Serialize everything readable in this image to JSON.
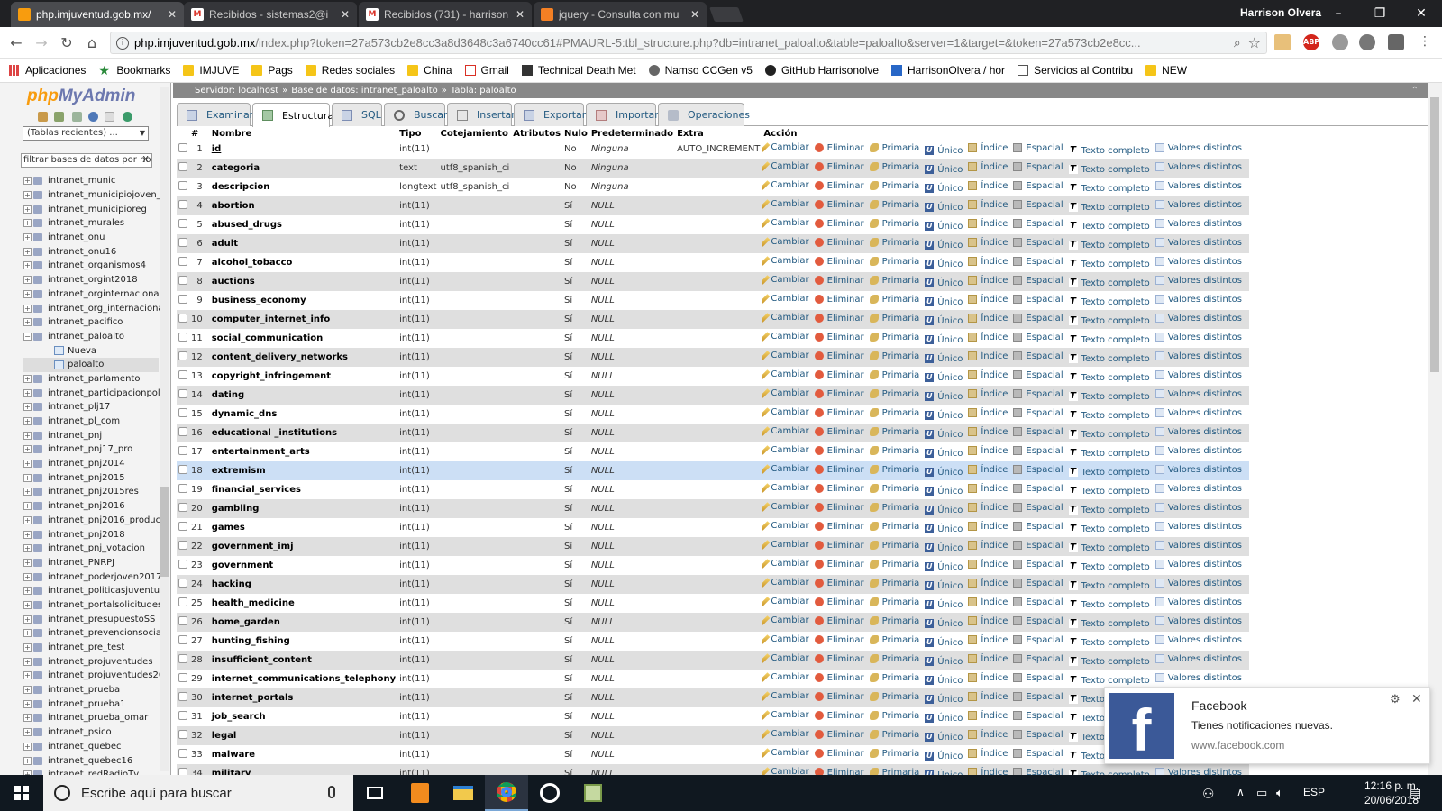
{
  "browser": {
    "tabs": [
      {
        "title": "php.imjuventud.gob.mx/",
        "icon": "pma-icon",
        "active": true
      },
      {
        "title": "Recibidos - sistemas2@i",
        "icon": "gmail-icon",
        "active": false
      },
      {
        "title": "Recibidos (731) - harrison",
        "icon": "gmail-icon",
        "active": false
      },
      {
        "title": "jquery - Consulta con mu",
        "icon": "stackoverflow-icon",
        "active": false
      }
    ],
    "user": "Harrison Olvera",
    "url_host": "php.imjuventud.gob.mx",
    "url_rest": "/index.php?token=27a573cb2e8cc3a8d3648c3a6740cc61#PMAURL-5:tbl_structure.php?db=intranet_paloalto&table=paloalto&server=1&target=&token=27a573cb2e8cc...",
    "bookmarks": [
      "Aplicaciones",
      "Bookmarks",
      "IMJUVE",
      "Pags",
      "Redes sociales",
      "China",
      "Gmail",
      "Technical Death Met",
      "Namso CCGen v5",
      "GitHub Harrisonolve",
      "HarrisonOlvera / hor",
      "Servicios al Contribu",
      "NEW"
    ]
  },
  "sidebar": {
    "logo_php": "php",
    "logo_myadmin": "MyAdmin",
    "recent": "(Tablas recientes) ...",
    "filter_placeholder": "filtrar bases de datos por nom",
    "tree": [
      {
        "name": "intranet_munic",
        "type": "db"
      },
      {
        "name": "intranet_municipiojoven_",
        "type": "db"
      },
      {
        "name": "intranet_municipioreg",
        "type": "db"
      },
      {
        "name": "intranet_murales",
        "type": "db"
      },
      {
        "name": "intranet_onu",
        "type": "db"
      },
      {
        "name": "intranet_onu16",
        "type": "db"
      },
      {
        "name": "intranet_organismos4",
        "type": "db"
      },
      {
        "name": "intranet_orgint2018",
        "type": "db"
      },
      {
        "name": "intranet_orginternacional",
        "type": "db"
      },
      {
        "name": "intranet_org_internaciona",
        "type": "db"
      },
      {
        "name": "intranet_pacifico",
        "type": "db"
      },
      {
        "name": "intranet_paloalto",
        "type": "db-open"
      },
      {
        "name": "Nueva",
        "type": "new"
      },
      {
        "name": "paloalto",
        "type": "table"
      },
      {
        "name": "intranet_parlamento",
        "type": "db"
      },
      {
        "name": "intranet_participacionpoli",
        "type": "db"
      },
      {
        "name": "intranet_plj17",
        "type": "db"
      },
      {
        "name": "intranet_pl_com",
        "type": "db"
      },
      {
        "name": "intranet_pnj",
        "type": "db"
      },
      {
        "name": "intranet_pnj17_pro",
        "type": "db"
      },
      {
        "name": "intranet_pnj2014",
        "type": "db"
      },
      {
        "name": "intranet_pnj2015",
        "type": "db"
      },
      {
        "name": "intranet_pnj2015res",
        "type": "db"
      },
      {
        "name": "intranet_pnj2016",
        "type": "db"
      },
      {
        "name": "intranet_pnj2016_produc",
        "type": "db"
      },
      {
        "name": "intranet_pnj2018",
        "type": "db"
      },
      {
        "name": "intranet_pnj_votacion",
        "type": "db"
      },
      {
        "name": "intranet_PNRPJ",
        "type": "db"
      },
      {
        "name": "intranet_poderjoven2017",
        "type": "db"
      },
      {
        "name": "intranet_politicasjuventuc",
        "type": "db"
      },
      {
        "name": "intranet_portalsolicitudes",
        "type": "db"
      },
      {
        "name": "intranet_presupuestoSS",
        "type": "db"
      },
      {
        "name": "intranet_prevencionsocia",
        "type": "db"
      },
      {
        "name": "intranet_pre_test",
        "type": "db"
      },
      {
        "name": "intranet_projuventudes",
        "type": "db"
      },
      {
        "name": "intranet_projuventudes20",
        "type": "db"
      },
      {
        "name": "intranet_prueba",
        "type": "db"
      },
      {
        "name": "intranet_prueba1",
        "type": "db"
      },
      {
        "name": "intranet_prueba_omar",
        "type": "db"
      },
      {
        "name": "intranet_psico",
        "type": "db"
      },
      {
        "name": "intranet_quebec",
        "type": "db"
      },
      {
        "name": "intranet_quebec16",
        "type": "db"
      },
      {
        "name": "intranet_redRadioTv",
        "type": "db"
      }
    ]
  },
  "breadcrumb": {
    "server": "Servidor: localhost",
    "database": "Base de datos: intranet_paloalto",
    "table": "Tabla: paloalto"
  },
  "tabs": [
    "Examinar",
    "Estructura",
    "SQL",
    "Buscar",
    "Insertar",
    "Exportar",
    "Importar",
    "Operaciones"
  ],
  "active_tab": "Estructura",
  "columns": [
    "#",
    "Nombre",
    "Tipo",
    "Cotejamiento",
    "Atributos",
    "Nulo",
    "Predeterminado",
    "Extra",
    "Acción"
  ],
  "actions": [
    "Cambiar",
    "Eliminar",
    "Primaria",
    "Único",
    "Índice",
    "Espacial",
    "Texto completo",
    "Valores distintos"
  ],
  "rows": [
    {
      "n": "1",
      "name": "id",
      "type": "int(11)",
      "collation": "",
      "null": "No",
      "default": "Ninguna",
      "extra": "AUTO_INCREMENT"
    },
    {
      "n": "2",
      "name": "categoria",
      "type": "text",
      "collation": "utf8_spanish_ci",
      "null": "No",
      "default": "Ninguna",
      "extra": ""
    },
    {
      "n": "3",
      "name": "descripcion",
      "type": "longtext",
      "collation": "utf8_spanish_ci",
      "null": "No",
      "default": "Ninguna",
      "extra": ""
    },
    {
      "n": "4",
      "name": "abortion",
      "type": "int(11)",
      "collation": "",
      "null": "Sí",
      "default": "NULL",
      "extra": ""
    },
    {
      "n": "5",
      "name": "abused_drugs",
      "type": "int(11)",
      "collation": "",
      "null": "Sí",
      "default": "NULL",
      "extra": ""
    },
    {
      "n": "6",
      "name": "adult",
      "type": "int(11)",
      "collation": "",
      "null": "Sí",
      "default": "NULL",
      "extra": ""
    },
    {
      "n": "7",
      "name": "alcohol_tobacco",
      "type": "int(11)",
      "collation": "",
      "null": "Sí",
      "default": "NULL",
      "extra": ""
    },
    {
      "n": "8",
      "name": "auctions",
      "type": "int(11)",
      "collation": "",
      "null": "Sí",
      "default": "NULL",
      "extra": ""
    },
    {
      "n": "9",
      "name": "business_economy",
      "type": "int(11)",
      "collation": "",
      "null": "Sí",
      "default": "NULL",
      "extra": ""
    },
    {
      "n": "10",
      "name": "computer_internet_info",
      "type": "int(11)",
      "collation": "",
      "null": "Sí",
      "default": "NULL",
      "extra": ""
    },
    {
      "n": "11",
      "name": "social_communication",
      "type": "int(11)",
      "collation": "",
      "null": "Sí",
      "default": "NULL",
      "extra": ""
    },
    {
      "n": "12",
      "name": "content_delivery_networks",
      "type": "int(11)",
      "collation": "",
      "null": "Sí",
      "default": "NULL",
      "extra": ""
    },
    {
      "n": "13",
      "name": "copyright_infringement",
      "type": "int(11)",
      "collation": "",
      "null": "Sí",
      "default": "NULL",
      "extra": ""
    },
    {
      "n": "14",
      "name": "dating",
      "type": "int(11)",
      "collation": "",
      "null": "Sí",
      "default": "NULL",
      "extra": ""
    },
    {
      "n": "15",
      "name": "dynamic_dns",
      "type": "int(11)",
      "collation": "",
      "null": "Sí",
      "default": "NULL",
      "extra": ""
    },
    {
      "n": "16",
      "name": "educational _institutions",
      "type": "int(11)",
      "collation": "",
      "null": "Sí",
      "default": "NULL",
      "extra": ""
    },
    {
      "n": "17",
      "name": "entertainment_arts",
      "type": "int(11)",
      "collation": "",
      "null": "Sí",
      "default": "NULL",
      "extra": ""
    },
    {
      "n": "18",
      "name": "extremism",
      "type": "int(11)",
      "collation": "",
      "null": "Sí",
      "default": "NULL",
      "extra": ""
    },
    {
      "n": "19",
      "name": "financial_services",
      "type": "int(11)",
      "collation": "",
      "null": "Sí",
      "default": "NULL",
      "extra": ""
    },
    {
      "n": "20",
      "name": "gambling",
      "type": "int(11)",
      "collation": "",
      "null": "Sí",
      "default": "NULL",
      "extra": ""
    },
    {
      "n": "21",
      "name": "games",
      "type": "int(11)",
      "collation": "",
      "null": "Sí",
      "default": "NULL",
      "extra": ""
    },
    {
      "n": "22",
      "name": "government_imj",
      "type": "int(11)",
      "collation": "",
      "null": "Sí",
      "default": "NULL",
      "extra": ""
    },
    {
      "n": "23",
      "name": "government",
      "type": "int(11)",
      "collation": "",
      "null": "Sí",
      "default": "NULL",
      "extra": ""
    },
    {
      "n": "24",
      "name": "hacking",
      "type": "int(11)",
      "collation": "",
      "null": "Sí",
      "default": "NULL",
      "extra": ""
    },
    {
      "n": "25",
      "name": "health_medicine",
      "type": "int(11)",
      "collation": "",
      "null": "Sí",
      "default": "NULL",
      "extra": ""
    },
    {
      "n": "26",
      "name": "home_garden",
      "type": "int(11)",
      "collation": "",
      "null": "Sí",
      "default": "NULL",
      "extra": ""
    },
    {
      "n": "27",
      "name": "hunting_fishing",
      "type": "int(11)",
      "collation": "",
      "null": "Sí",
      "default": "NULL",
      "extra": ""
    },
    {
      "n": "28",
      "name": "insufficient_content",
      "type": "int(11)",
      "collation": "",
      "null": "Sí",
      "default": "NULL",
      "extra": ""
    },
    {
      "n": "29",
      "name": "internet_communications_telephony",
      "type": "int(11)",
      "collation": "",
      "null": "Sí",
      "default": "NULL",
      "extra": ""
    },
    {
      "n": "30",
      "name": "internet_portals",
      "type": "int(11)",
      "collation": "",
      "null": "Sí",
      "default": "NULL",
      "extra": ""
    },
    {
      "n": "31",
      "name": "job_search",
      "type": "int(11)",
      "collation": "",
      "null": "Sí",
      "default": "NULL",
      "extra": ""
    },
    {
      "n": "32",
      "name": "legal",
      "type": "int(11)",
      "collation": "",
      "null": "Sí",
      "default": "NULL",
      "extra": ""
    },
    {
      "n": "33",
      "name": "malware",
      "type": "int(11)",
      "collation": "",
      "null": "Sí",
      "default": "NULL",
      "extra": ""
    },
    {
      "n": "34",
      "name": "military",
      "type": "int(11)",
      "collation": "",
      "null": "Sí",
      "default": "NULL",
      "extra": ""
    }
  ],
  "highlighted_row": "18",
  "notification": {
    "title": "Facebook",
    "body": "Tienes notificaciones nuevas.",
    "source": "www.facebook.com"
  },
  "taskbar": {
    "search": "Escribe aquí para buscar",
    "lang": "ESP",
    "time": "12:16 p. m.",
    "date": "20/06/2018"
  }
}
